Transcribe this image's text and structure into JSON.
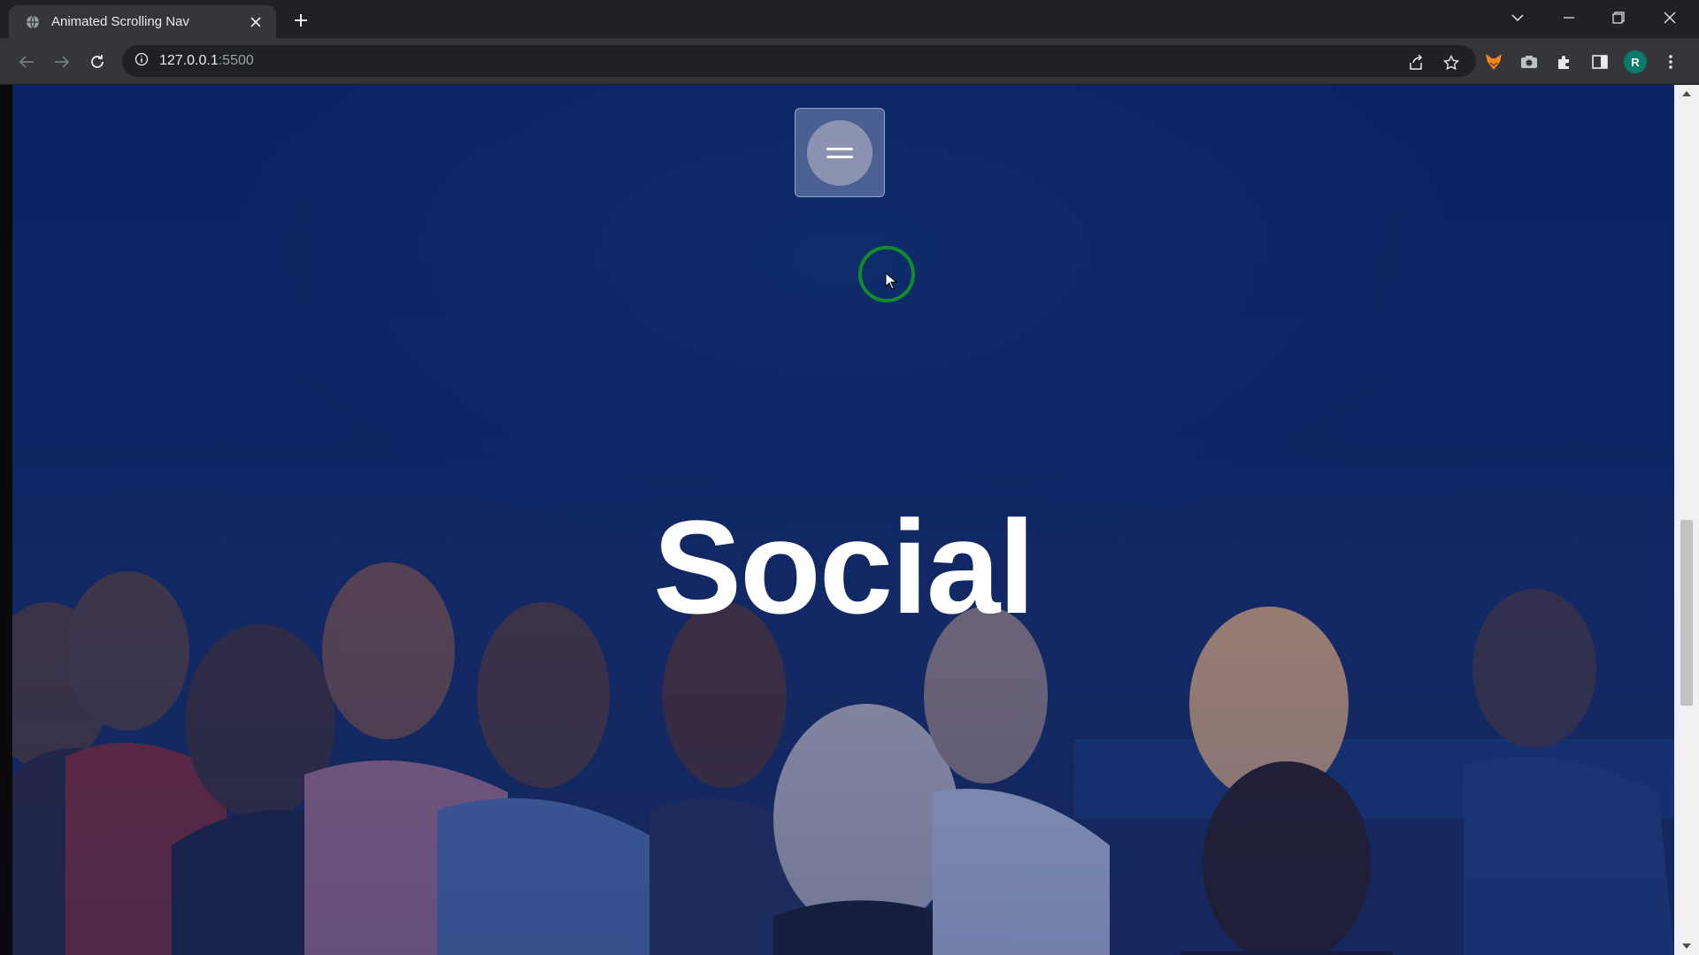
{
  "browser": {
    "tab": {
      "title": "Animated Scrolling Nav",
      "favicon": "globe-icon",
      "close_icon": "close-icon"
    },
    "new_tab_icon": "plus-icon",
    "window_controls": [
      "chevron-down-icon",
      "minimize-icon",
      "restore-icon",
      "close-icon"
    ],
    "address_bar": {
      "host": "127.0.0.1",
      "port": ":5500",
      "security_icon": "info-icon"
    },
    "toolbar_icons": [
      "share-icon",
      "star-icon",
      "fox-extension-icon",
      "camera-extension-icon",
      "puzzle-icon",
      "sidepanel-icon"
    ],
    "profile_initial": "R",
    "menu_icon": "kebab-menu-icon"
  },
  "page": {
    "heading": "Social",
    "nav_toggle_icon": "hamburger-icon",
    "background_color": "#0c2562",
    "cursor_ring_color": "#118a2c"
  }
}
